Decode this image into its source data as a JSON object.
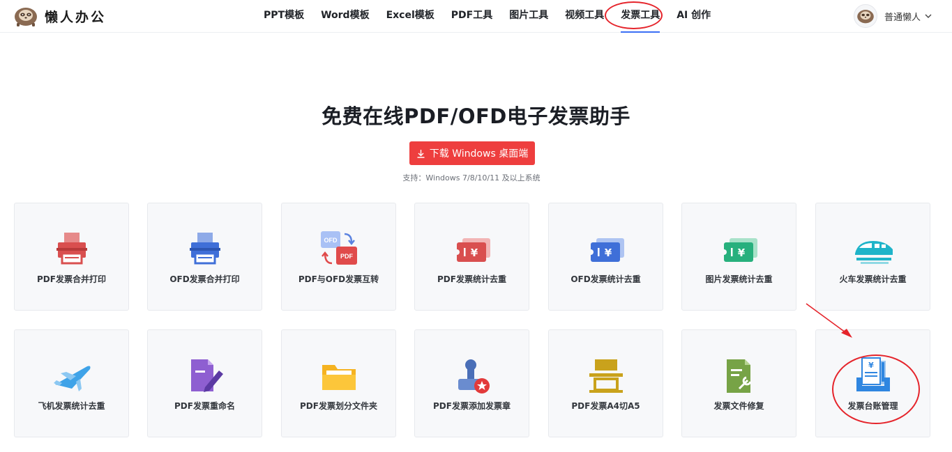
{
  "header": {
    "brand": "懒人办公",
    "nav": [
      "PPT模板",
      "Word模板",
      "Excel模板",
      "PDF工具",
      "图片工具",
      "视频工具",
      "发票工具",
      "AI 创作"
    ],
    "active_nav": "发票工具",
    "user_name": "普通懒人"
  },
  "hero": {
    "title": "免费在线PDF/OFD电子发票助手",
    "download_label": "下载 Windows 桌面端",
    "support_text": "支持：Windows 7/8/10/11 及以上系统"
  },
  "tools": [
    {
      "label": "PDF发票合并打印",
      "icon": "printer-icon",
      "color": "#d94f4f"
    },
    {
      "label": "OFD发票合并打印",
      "icon": "printer-icon",
      "color": "#3f6fd8"
    },
    {
      "label": "PDF与OFD发票互转",
      "icon": "convert-icon",
      "color": "#e04b4b"
    },
    {
      "label": "PDF发票统计去重",
      "icon": "ticket-icon",
      "color": "#d94f4f"
    },
    {
      "label": "OFD发票统计去重",
      "icon": "ticket-icon",
      "color": "#3f6fd8"
    },
    {
      "label": "图片发票统计去重",
      "icon": "ticket-icon",
      "color": "#27b07d"
    },
    {
      "label": "火车发票统计去重",
      "icon": "train-icon",
      "color": "#1fb4c9"
    },
    {
      "label": "飞机发票统计去重",
      "icon": "plane-icon",
      "color": "#3fa3e8"
    },
    {
      "label": "PDF发票重命名",
      "icon": "rename-icon",
      "color": "#8e5fd1"
    },
    {
      "label": "PDF发票划分文件夹",
      "icon": "folder-icon",
      "color": "#f5b321"
    },
    {
      "label": "PDF发票添加发票章",
      "icon": "stamp-icon",
      "color": "#4a6fb8"
    },
    {
      "label": "PDF发票A4切A5",
      "icon": "cut-icon",
      "color": "#c9a21c"
    },
    {
      "label": "发票文件修复",
      "icon": "repair-icon",
      "color": "#77a346"
    },
    {
      "label": "发票台账管理",
      "icon": "ledger-icon",
      "color": "#2f86e0"
    }
  ]
}
